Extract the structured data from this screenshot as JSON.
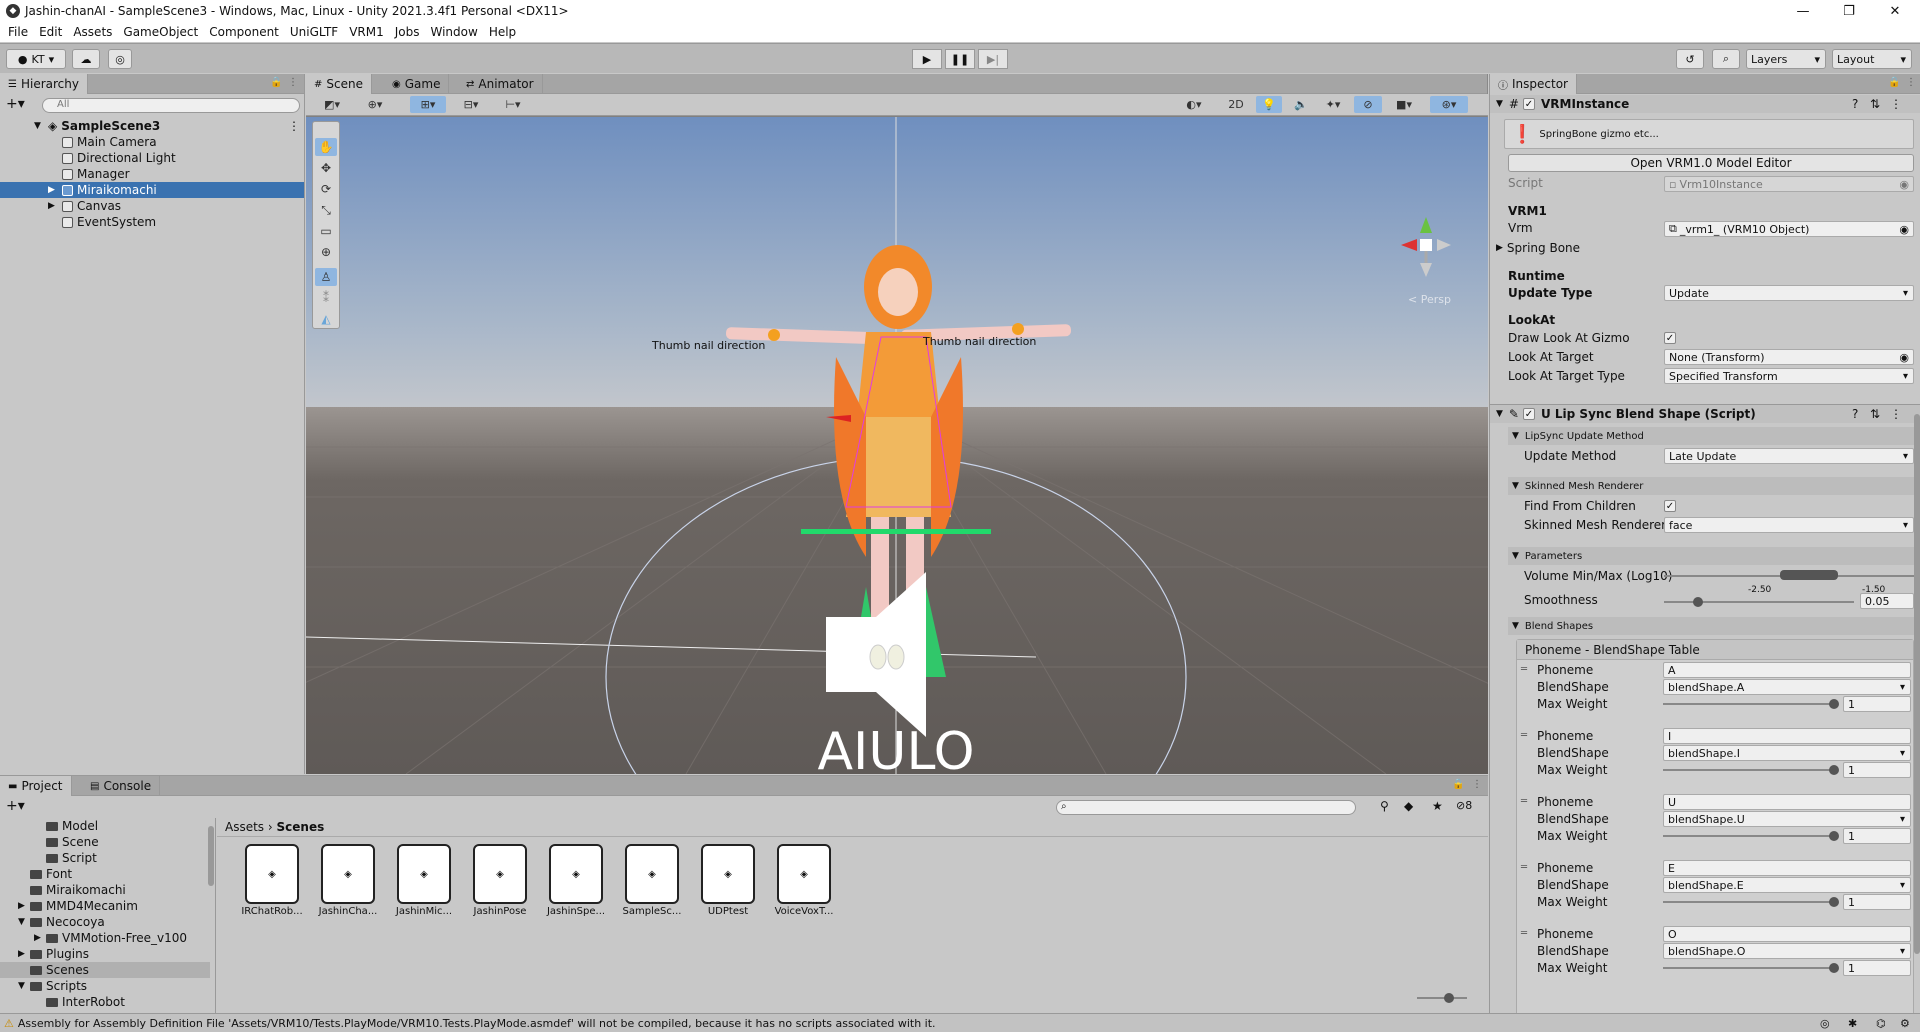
{
  "window": {
    "title": "Jashin-chanAI - SampleScene3 - Windows, Mac, Linux - Unity 2021.3.4f1 Personal <DX11>"
  },
  "menu": [
    "File",
    "Edit",
    "Assets",
    "GameObject",
    "Component",
    "UniGLTF",
    "VRM1",
    "Jobs",
    "Window",
    "Help"
  ],
  "toolbar": {
    "account": "KT",
    "layers": "Layers",
    "layout": "Layout"
  },
  "hierarchy": {
    "tab": "Hierarchy",
    "search_placeholder": "All",
    "scene": "SampleScene3",
    "items": [
      "Main Camera",
      "Directional Light",
      "Manager",
      "Miraikomachi",
      "Canvas",
      "EventSystem"
    ]
  },
  "scene_tabs": [
    "Scene",
    "Game",
    "Animator"
  ],
  "scene": {
    "mode_2d": "2D",
    "persp": "< Persp",
    "label_left": "Thumb nail direction",
    "label_right": "Thumb nail direction",
    "overlay_text": "AIULO"
  },
  "project": {
    "tabs": [
      "Project",
      "Console"
    ],
    "breadcrumb_root": "Assets",
    "breadcrumb_current": "Scenes",
    "hidden_count": "8",
    "tree": [
      "Model",
      "Scene",
      "Script",
      "Font",
      "Miraikomachi",
      "MMD4Mecanim",
      "Necocoya",
      "VMMotion-Free_v100",
      "Plugins",
      "Scenes",
      "Scripts",
      "InterRobot"
    ],
    "assets": [
      "IRChatRob...",
      "JashinCha...",
      "JashinMic...",
      "JashinPose",
      "JashinSpe...",
      "SampleSc...",
      "UDPtest",
      "VoiceVoxT..."
    ]
  },
  "inspector": {
    "tab": "Inspector",
    "component1": "VRMInstance",
    "info": "SpringBone gizmo etc...",
    "open_editor": "Open VRM1.0 Model Editor",
    "script_label": "Script",
    "script_value": "Vrm10Instance",
    "vrm1_header": "VRM1",
    "vrm_label": "Vrm",
    "vrm_value": "_vrm1_ (VRM10 Object)",
    "spring_bone": "Spring Bone",
    "runtime_header": "Runtime",
    "update_type_label": "Update Type",
    "update_type_value": "Update",
    "lookat_header": "LookAt",
    "draw_lookat_label": "Draw Look At Gizmo",
    "lookat_target_label": "Look At Target",
    "lookat_target_value": "None (Transform)",
    "lookat_target_type_label": "Look At Target Type",
    "lookat_target_type_value": "Specified Transform",
    "component2": "U Lip Sync Blend Shape (Script)",
    "sec_update": "LipSync Update Method",
    "update_method_label": "Update Method",
    "update_method_value": "Late Update",
    "sec_smr": "Skinned Mesh Renderer",
    "find_children_label": "Find From Children",
    "smr_label": "Skinned Mesh Renderer",
    "smr_value": "face",
    "sec_params": "Parameters",
    "volume_label": "Volume Min/Max (Log10)",
    "volume_min": "-2.50",
    "volume_max": "-1.50",
    "smoothness_label": "Smoothness",
    "smoothness_value": "0.05",
    "sec_blend": "Blend Shapes",
    "table_header": "Phoneme - BlendShape Table",
    "phoneme_label": "Phoneme",
    "blendshape_label": "BlendShape",
    "maxweight_label": "Max Weight",
    "phonemes": [
      {
        "phoneme": "A",
        "blendshape": "blendShape.A",
        "weight": "1"
      },
      {
        "phoneme": "I",
        "blendshape": "blendShape.I",
        "weight": "1"
      },
      {
        "phoneme": "U",
        "blendshape": "blendShape.U",
        "weight": "1"
      },
      {
        "phoneme": "E",
        "blendshape": "blendShape.E",
        "weight": "1"
      },
      {
        "phoneme": "O",
        "blendshape": "blendShape.O",
        "weight": "1"
      }
    ]
  },
  "status": {
    "message": "Assembly for Assembly Definition File 'Assets/VRM10/Tests.PlayMode/VRM10.Tests.PlayMode.asmdef' will not be compiled, because it has no scripts associated with it."
  }
}
